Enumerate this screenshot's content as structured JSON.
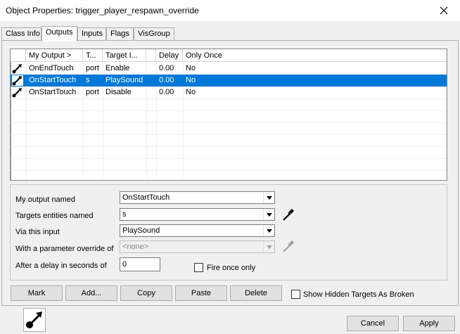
{
  "window": {
    "title": "Object Properties: trigger_player_respawn_override"
  },
  "tabs": [
    {
      "label": "Class Info"
    },
    {
      "label": "Outputs"
    },
    {
      "label": "Inputs"
    },
    {
      "label": "Flags"
    },
    {
      "label": "VisGroup"
    }
  ],
  "outputs_list": {
    "columns": [
      "My Output  >",
      "T...",
      "Target I...",
      "",
      "Delay",
      "Only Once"
    ],
    "rows": [
      {
        "output": "OnEndTouch",
        "target": "port",
        "input": "Enable",
        "delay": "0.00",
        "once": "No",
        "selected": false
      },
      {
        "output": "OnStartTouch",
        "target": "s",
        "input": "PlaySound",
        "delay": "0.00",
        "once": "No",
        "selected": true
      },
      {
        "output": "OnStartTouch",
        "target": "port",
        "input": "Disable",
        "delay": "0.00",
        "once": "No",
        "selected": false
      }
    ]
  },
  "editor": {
    "output_label": "My output named",
    "output_value": "OnStartTouch",
    "targets_label": "Targets entities named",
    "targets_value": "s",
    "input_label": "Via this input",
    "input_value": "PlaySound",
    "param_label": "With a parameter override of",
    "param_value": "<none>",
    "delay_label": "After a delay in seconds of",
    "delay_value": "0",
    "fire_once_label": "Fire once only"
  },
  "buttons": {
    "mark": "Mark",
    "add": "Add...",
    "copy": "Copy",
    "paste": "Paste",
    "delete": "Delete",
    "show_hidden": "Show Hidden Targets As Broken",
    "cancel": "Cancel",
    "apply": "Apply"
  },
  "colors": {
    "selection": "#0078d7",
    "window_bg": "#f0f0f0"
  },
  "icons": [
    "close-icon",
    "output-connection-icon",
    "eyedropper-icon",
    "dropdown-arrow-icon"
  ]
}
